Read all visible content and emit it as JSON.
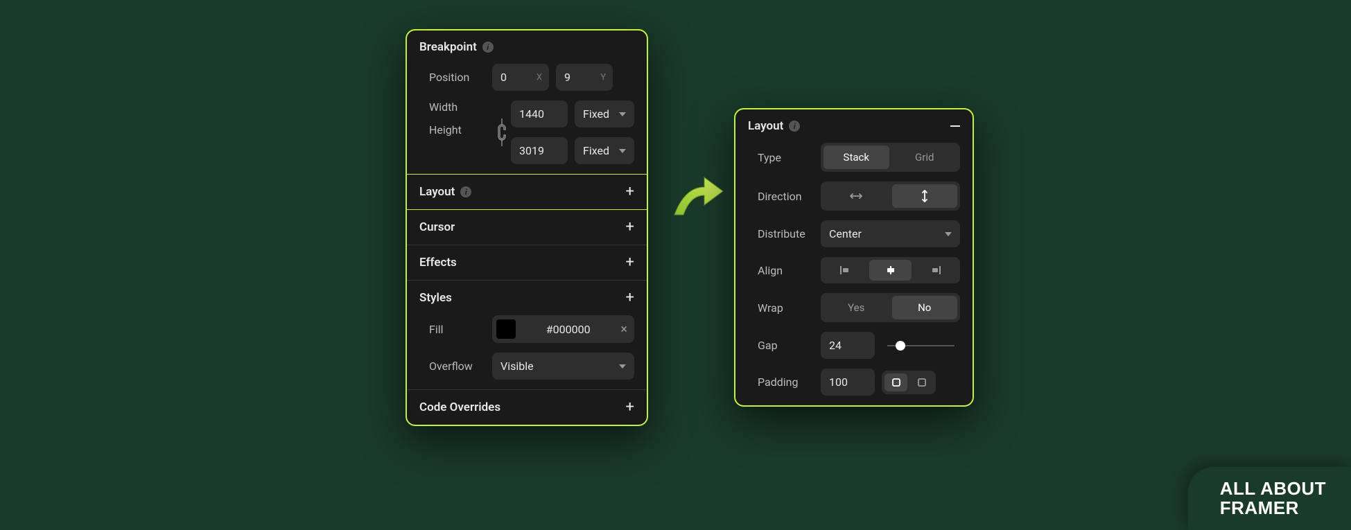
{
  "left_panel": {
    "breakpoint": {
      "title": "Breakpoint",
      "position_label": "Position",
      "position_x": "0",
      "position_x_suffix": "X",
      "position_y": "9",
      "position_y_suffix": "Y",
      "width_label": "Width",
      "width_value": "1440",
      "width_mode": "Fixed",
      "height_label": "Height",
      "height_value": "3019",
      "height_mode": "Fixed"
    },
    "layout": {
      "title": "Layout"
    },
    "cursor": {
      "title": "Cursor"
    },
    "effects": {
      "title": "Effects"
    },
    "styles": {
      "title": "Styles",
      "fill_label": "Fill",
      "fill_value": "#000000",
      "overflow_label": "Overflow",
      "overflow_value": "Visible"
    },
    "code_overrides": {
      "title": "Code Overrides"
    }
  },
  "right_panel": {
    "title": "Layout",
    "type_label": "Type",
    "type_options": [
      "Stack",
      "Grid"
    ],
    "type_active": "Stack",
    "direction_label": "Direction",
    "direction_active": "vertical",
    "distribute_label": "Distribute",
    "distribute_value": "Center",
    "align_label": "Align",
    "align_active": "center",
    "wrap_label": "Wrap",
    "wrap_options": [
      "Yes",
      "No"
    ],
    "wrap_active": "No",
    "gap_label": "Gap",
    "gap_value": "24",
    "padding_label": "Padding",
    "padding_value": "100"
  },
  "brand": {
    "line1": "ALL ABOUT",
    "line2": "FRAMER"
  }
}
